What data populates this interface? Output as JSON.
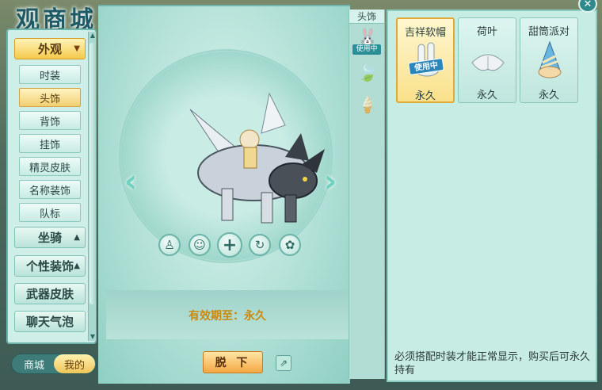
{
  "window": {
    "title_art": "观商城",
    "close_label": "✕"
  },
  "sidebar": {
    "categories": [
      {
        "label": "外观",
        "expanded": true
      },
      {
        "label": "坐骑",
        "expanded": false
      },
      {
        "label": "个性装饰",
        "expanded": false
      },
      {
        "label": "武器皮肤",
        "expanded": false
      },
      {
        "label": "聊天气泡",
        "expanded": false
      }
    ],
    "sub_items": [
      {
        "label": "时装",
        "selected": false
      },
      {
        "label": "头饰",
        "selected": true
      },
      {
        "label": "背饰",
        "selected": false
      },
      {
        "label": "挂饰",
        "selected": false
      },
      {
        "label": "精灵皮肤",
        "selected": false
      },
      {
        "label": "名称装饰",
        "selected": false
      },
      {
        "label": "队标",
        "selected": false
      }
    ]
  },
  "bottom_toggle": {
    "left_label": "商城",
    "right_label": "我的",
    "active": "我的"
  },
  "preview": {
    "action_icons": [
      "person-icon",
      "expression-icon",
      "plus-icon",
      "rotate-icon",
      "dye-icon"
    ],
    "expiry_text": "有效期至：永久",
    "takeoff_label": "脱 下"
  },
  "strip": {
    "header": "头饰",
    "using_tag": "使用中",
    "icons": [
      "rabbit-hat-icon",
      "lotus-leaf-icon",
      "cone-hat-icon"
    ]
  },
  "items": [
    {
      "name": "吉祥软帽",
      "duration": "永久",
      "selected": true,
      "using_badge": "使用中"
    },
    {
      "name": "荷叶",
      "duration": "永久",
      "selected": false
    },
    {
      "name": "甜筒派对",
      "duration": "永久",
      "selected": false
    }
  ],
  "notice": "必须搭配时装才能正常显示，购买后可永久持有",
  "colors": {
    "accent_gold": "#f1c95c",
    "panel_teal": "#c7ece4",
    "expiry_text": "#c98a10",
    "using_badge": "#2d86b9"
  }
}
